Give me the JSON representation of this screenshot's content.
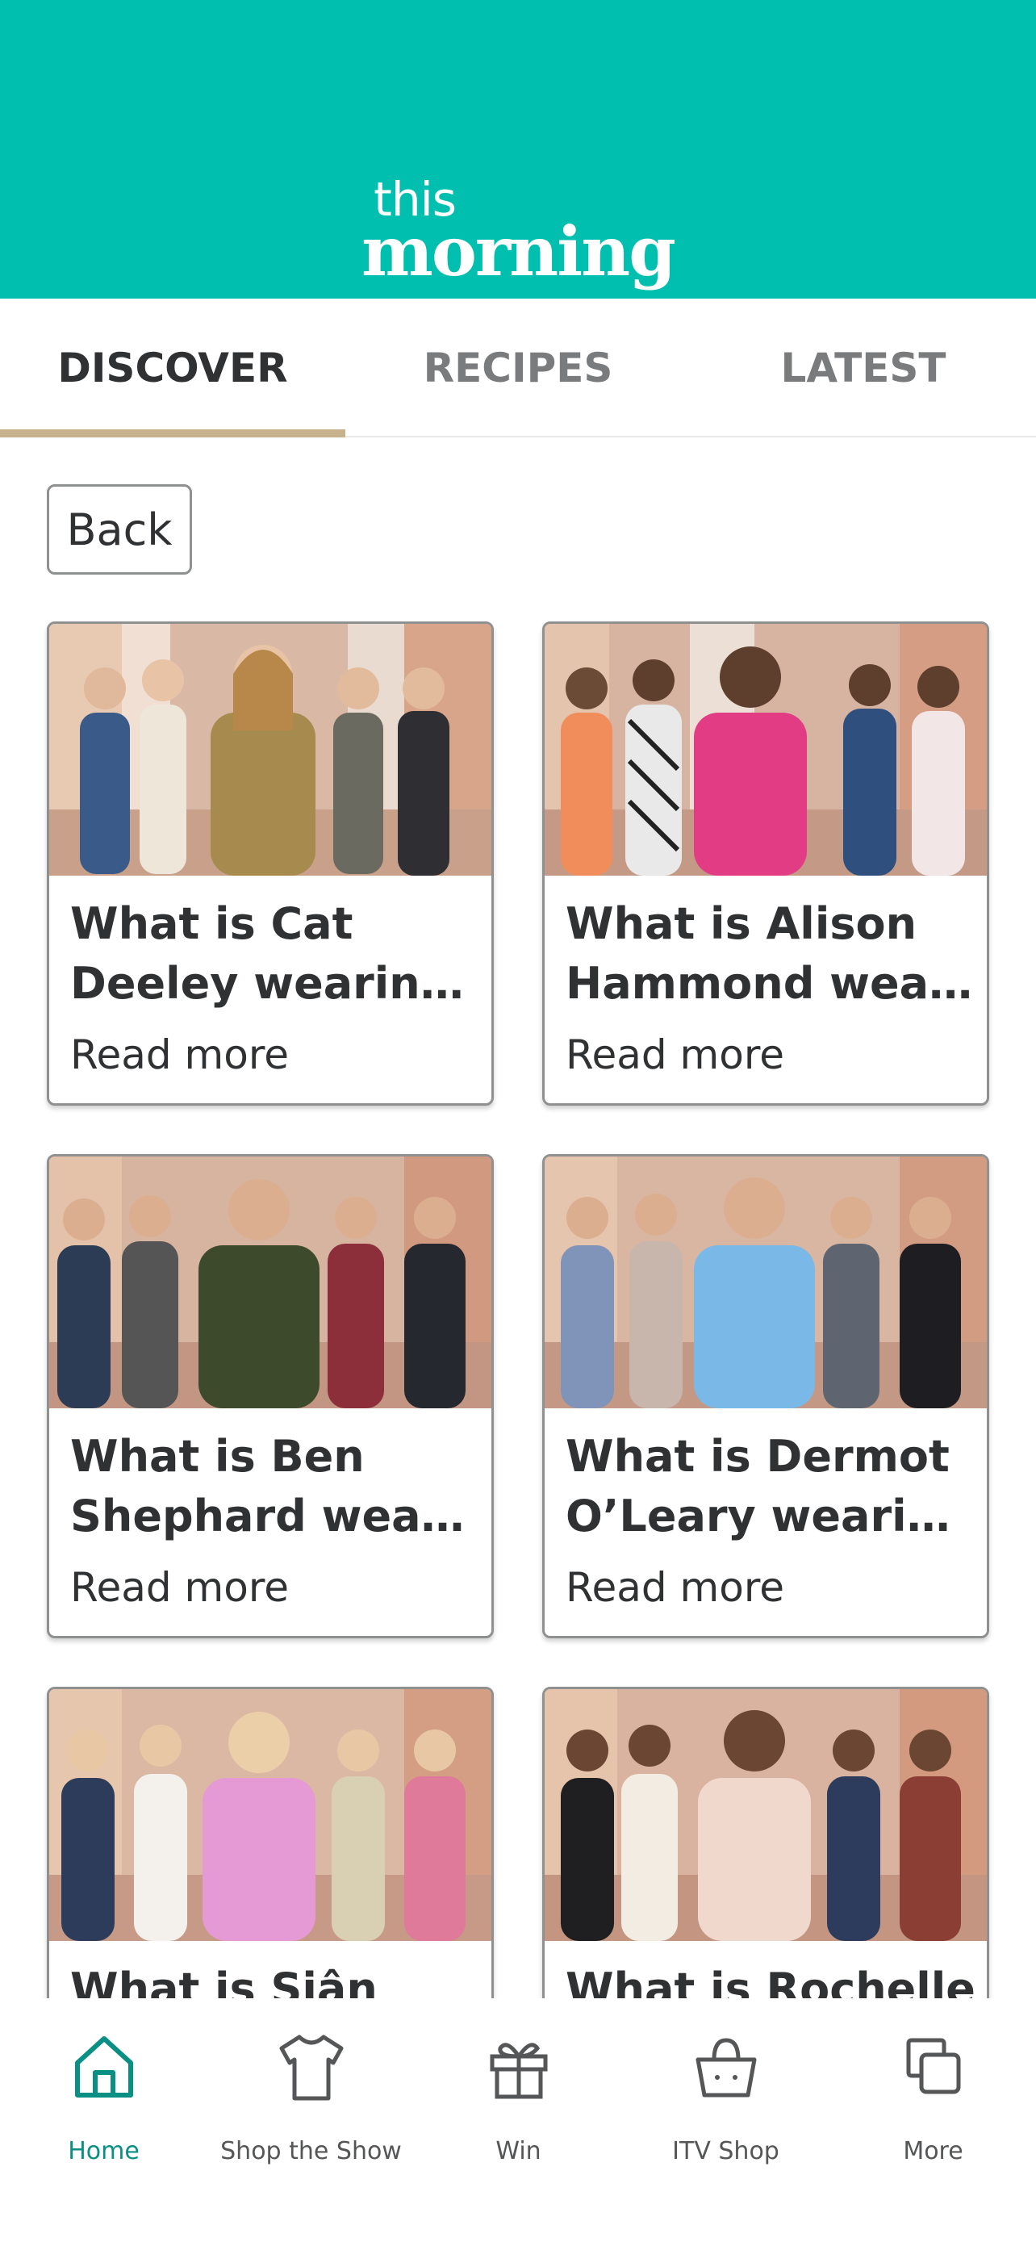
{
  "header": {
    "logo_this": "this",
    "logo_morning": "morning",
    "bg_color": "#00bfae"
  },
  "tabs": [
    {
      "label": "DISCOVER",
      "active": true
    },
    {
      "label": "RECIPES",
      "active": false
    },
    {
      "label": "LATEST",
      "active": false
    }
  ],
  "back_label": "Back",
  "cards": [
    {
      "line1": "What is Cat",
      "line2": "Deeley wearing t...",
      "more": "Read more",
      "photo": "cat-deeley-group-photo"
    },
    {
      "line1": "What is Alison",
      "line2": "Hammond weari...",
      "more": "Read more",
      "photo": "alison-hammond-group-photo"
    },
    {
      "line1": "What is Ben",
      "line2": "Shephard weari...",
      "more": "Read more",
      "photo": "ben-shephard-group-photo"
    },
    {
      "line1": "What is Dermot",
      "line2": "O’Leary wearing...",
      "more": "Read more",
      "photo": "dermot-oleary-group-photo"
    },
    {
      "line1": "What is Siân",
      "line2": "",
      "more": "",
      "photo": "sian-group-photo"
    },
    {
      "line1": "What is Rochelle",
      "line2": "",
      "more": "",
      "photo": "rochelle-group-photo"
    }
  ],
  "nav": [
    {
      "label": "Home",
      "icon": "home-icon",
      "active": true
    },
    {
      "label": "Shop the Show",
      "icon": "shirt-icon",
      "active": false
    },
    {
      "label": "Win",
      "icon": "gift-icon",
      "active": false
    },
    {
      "label": "ITV Shop",
      "icon": "basket-icon",
      "active": false
    },
    {
      "label": "More",
      "icon": "copy-squares-icon",
      "active": false
    }
  ],
  "colors": {
    "accent": "#00bfae",
    "tab_underline": "#c6b28c",
    "active_nav": "#0a8f84"
  }
}
